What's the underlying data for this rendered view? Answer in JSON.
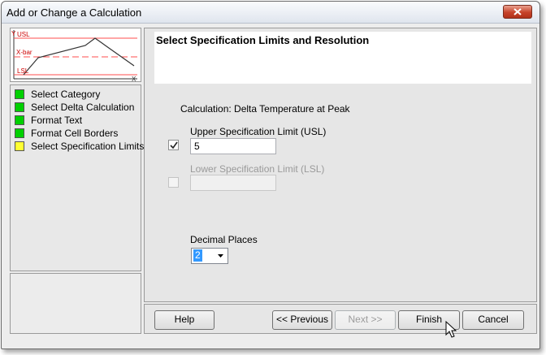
{
  "window": {
    "title": "Add or Change a Calculation"
  },
  "preview": {
    "usl_label": "USL",
    "xbar_label": "X-bar",
    "lsl_label": "LSL",
    "y_label": "Y",
    "x_label": "X"
  },
  "steps": [
    {
      "label": "Select Category",
      "status": "complete",
      "color": "#00d000"
    },
    {
      "label": "Select Delta Calculation",
      "status": "complete",
      "color": "#00d000"
    },
    {
      "label": "Format Text",
      "status": "complete",
      "color": "#00d000"
    },
    {
      "label": "Format Cell Borders",
      "status": "complete",
      "color": "#00d000"
    },
    {
      "label": "Select Specification Limits",
      "status": "current",
      "color": "#ffff33"
    }
  ],
  "page": {
    "heading": "Select Specification Limits and Resolution",
    "calculation": "Calculation: Delta Temperature at Peak",
    "usl": {
      "label": "Upper Specification Limit (USL)",
      "checked": true,
      "value": "5"
    },
    "lsl": {
      "label": "Lower Specification Limit (LSL)",
      "checked": false,
      "value": ""
    },
    "decimal": {
      "label": "Decimal Places",
      "value": "2"
    }
  },
  "buttons": {
    "help": "Help",
    "previous": "<< Previous",
    "next": "Next >>",
    "finish": "Finish",
    "cancel": "Cancel"
  }
}
